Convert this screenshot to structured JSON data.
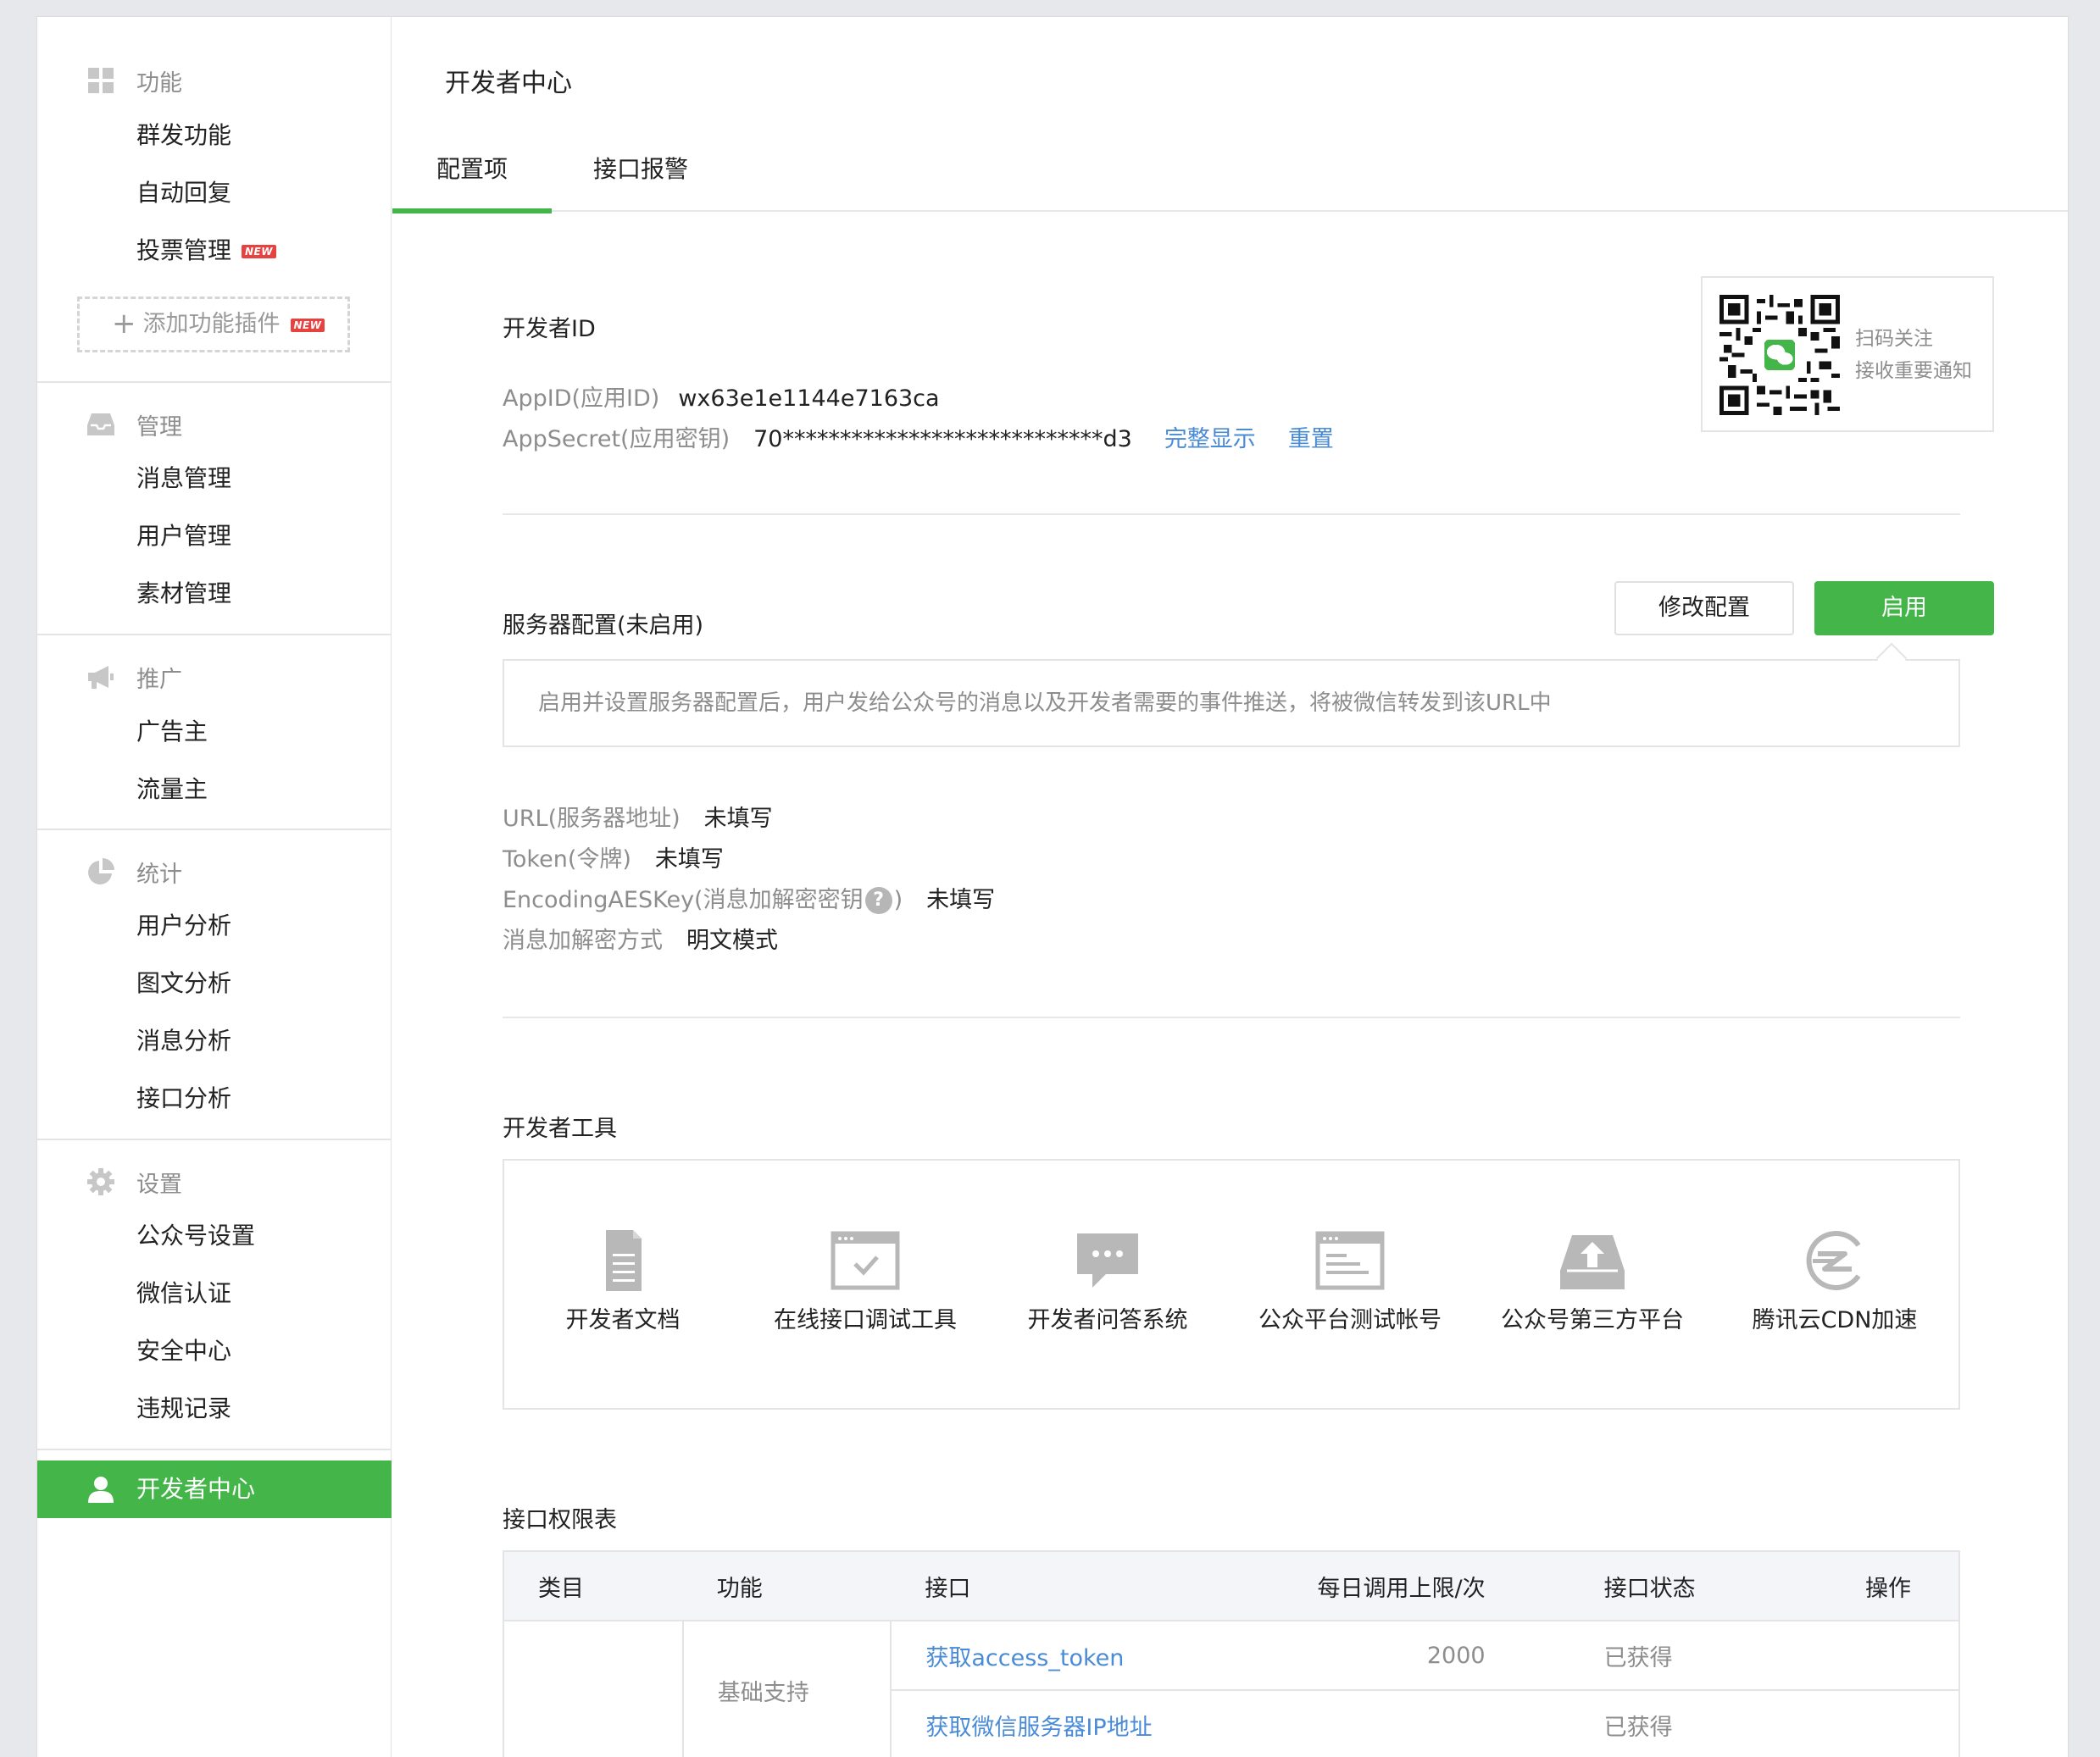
{
  "sidebar": {
    "sections": [
      {
        "title": "功能",
        "icon": "grid-icon",
        "items": [
          "群发功能",
          "自动回复",
          "投票管理"
        ]
      },
      {
        "title": "管理",
        "icon": "inbox-icon",
        "items": [
          "消息管理",
          "用户管理",
          "素材管理"
        ]
      },
      {
        "title": "推广",
        "icon": "megaphone-icon",
        "items": [
          "广告主",
          "流量主"
        ]
      },
      {
        "title": "统计",
        "icon": "pie-chart-icon",
        "items": [
          "用户分析",
          "图文分析",
          "消息分析",
          "接口分析"
        ]
      },
      {
        "title": "设置",
        "icon": "gear-icon",
        "items": [
          "公众号设置",
          "微信认证",
          "安全中心",
          "违规记录"
        ]
      }
    ],
    "new_badge": "NEW",
    "add_plugin": "添加功能插件",
    "active_item": "开发者中心"
  },
  "main": {
    "title": "开发者中心",
    "tabs": [
      "配置项",
      "接口报警"
    ],
    "developer_id": {
      "title": "开发者ID",
      "appid_label": "AppID(应用ID)",
      "appid_value": "wx63e1e1144e7163ca",
      "secret_label": "AppSecret(应用密钥)",
      "secret_value": "70****************************d3",
      "show_full": "完整显示",
      "reset": "重置"
    },
    "qr": {
      "line1": "扫码关注",
      "line2": "接收重要通知"
    },
    "server": {
      "title": "服务器配置(未启用)",
      "modify_btn": "修改配置",
      "enable_btn": "启用",
      "tip": "启用并设置服务器配置后，用户发给公众号的消息以及开发者需要的事件推送，将被微信转发到该URL中",
      "url_label": "URL(服务器地址)",
      "url_value": "未填写",
      "token_label": "Token(令牌)",
      "token_value": "未填写",
      "aes_label_prefix": "EncodingAESKey(消息加解密密钥",
      "aes_label_suffix": ")",
      "aes_value": "未填写",
      "mode_label": "消息加解密方式",
      "mode_value": "明文模式"
    },
    "tools": {
      "title": "开发者工具",
      "items": [
        {
          "label": "开发者文档",
          "icon": "document-icon"
        },
        {
          "label": "在线接口调试工具",
          "icon": "debug-window-icon"
        },
        {
          "label": "开发者问答系统",
          "icon": "chat-bubble-icon"
        },
        {
          "label": "公众平台测试帐号",
          "icon": "test-account-icon"
        },
        {
          "label": "公众号第三方平台",
          "icon": "upload-tray-icon"
        },
        {
          "label": "腾讯云CDN加速",
          "icon": "cdn-icon"
        }
      ]
    },
    "api_table": {
      "title": "接口权限表",
      "headers": [
        "类目",
        "功能",
        "接口",
        "每日调用上限/次",
        "接口状态",
        "操作"
      ],
      "category_cell": "",
      "function_cell": "基础支持",
      "rows": [
        {
          "api": "获取access_token",
          "limit": "2000",
          "status": "已获得",
          "op": ""
        },
        {
          "api": "获取微信服务器IP地址",
          "limit": "",
          "status": "已获得",
          "op": ""
        }
      ]
    }
  },
  "colors": {
    "brand_green": "#44b549",
    "link_blue": "#4a8bd6",
    "muted_gray": "#8d8d8d"
  }
}
